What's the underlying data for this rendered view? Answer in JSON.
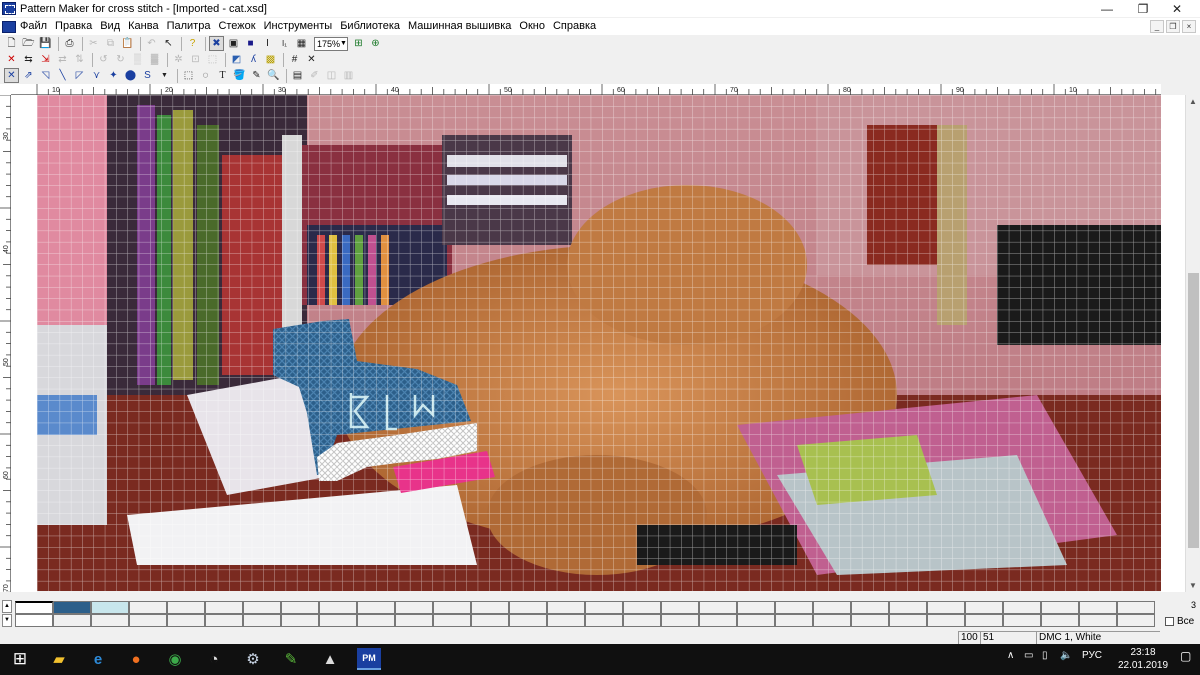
{
  "window": {
    "title": "Pattern Maker for cross stitch - [Imported - cat.xsd]",
    "minimize": "—",
    "maximize": "❐",
    "close": "✕"
  },
  "menubar": {
    "items": [
      "Файл",
      "Правка",
      "Вид",
      "Канва",
      "Палитра",
      "Стежок",
      "Инструменты",
      "Библиотека",
      "Машинная вышивка",
      "Окно",
      "Справка"
    ],
    "mdi_minimize": "_",
    "mdi_restore": "❐",
    "mdi_close": "×"
  },
  "toolbar1": {
    "zoom_value": "175%",
    "zoom_arrow": "▼"
  },
  "ruler": {
    "top_labels": [
      "10",
      "20",
      "30",
      "40",
      "50",
      "60",
      "70",
      "80",
      "90",
      "10"
    ],
    "left_labels": [
      "30",
      "40",
      "50",
      "60",
      "70"
    ]
  },
  "palette": {
    "colors": [
      "#ffffff",
      "#2c5f8a",
      "#c8e6ec"
    ],
    "empty_cell_color": "#f0f0f0",
    "counter": "3",
    "all_label": "Все"
  },
  "status": {
    "coord_x": "100",
    "coord_y": "51",
    "thread": "DMC  1, White"
  },
  "taskbar": {
    "lang": "РУС",
    "time": "23:18",
    "date": "22.01.2019"
  },
  "colors": {
    "grid_line": "#ffffff",
    "stitch_blue": "#2c5f8a",
    "stitch_white": "#ffffff",
    "highlight": "#e8338a"
  }
}
